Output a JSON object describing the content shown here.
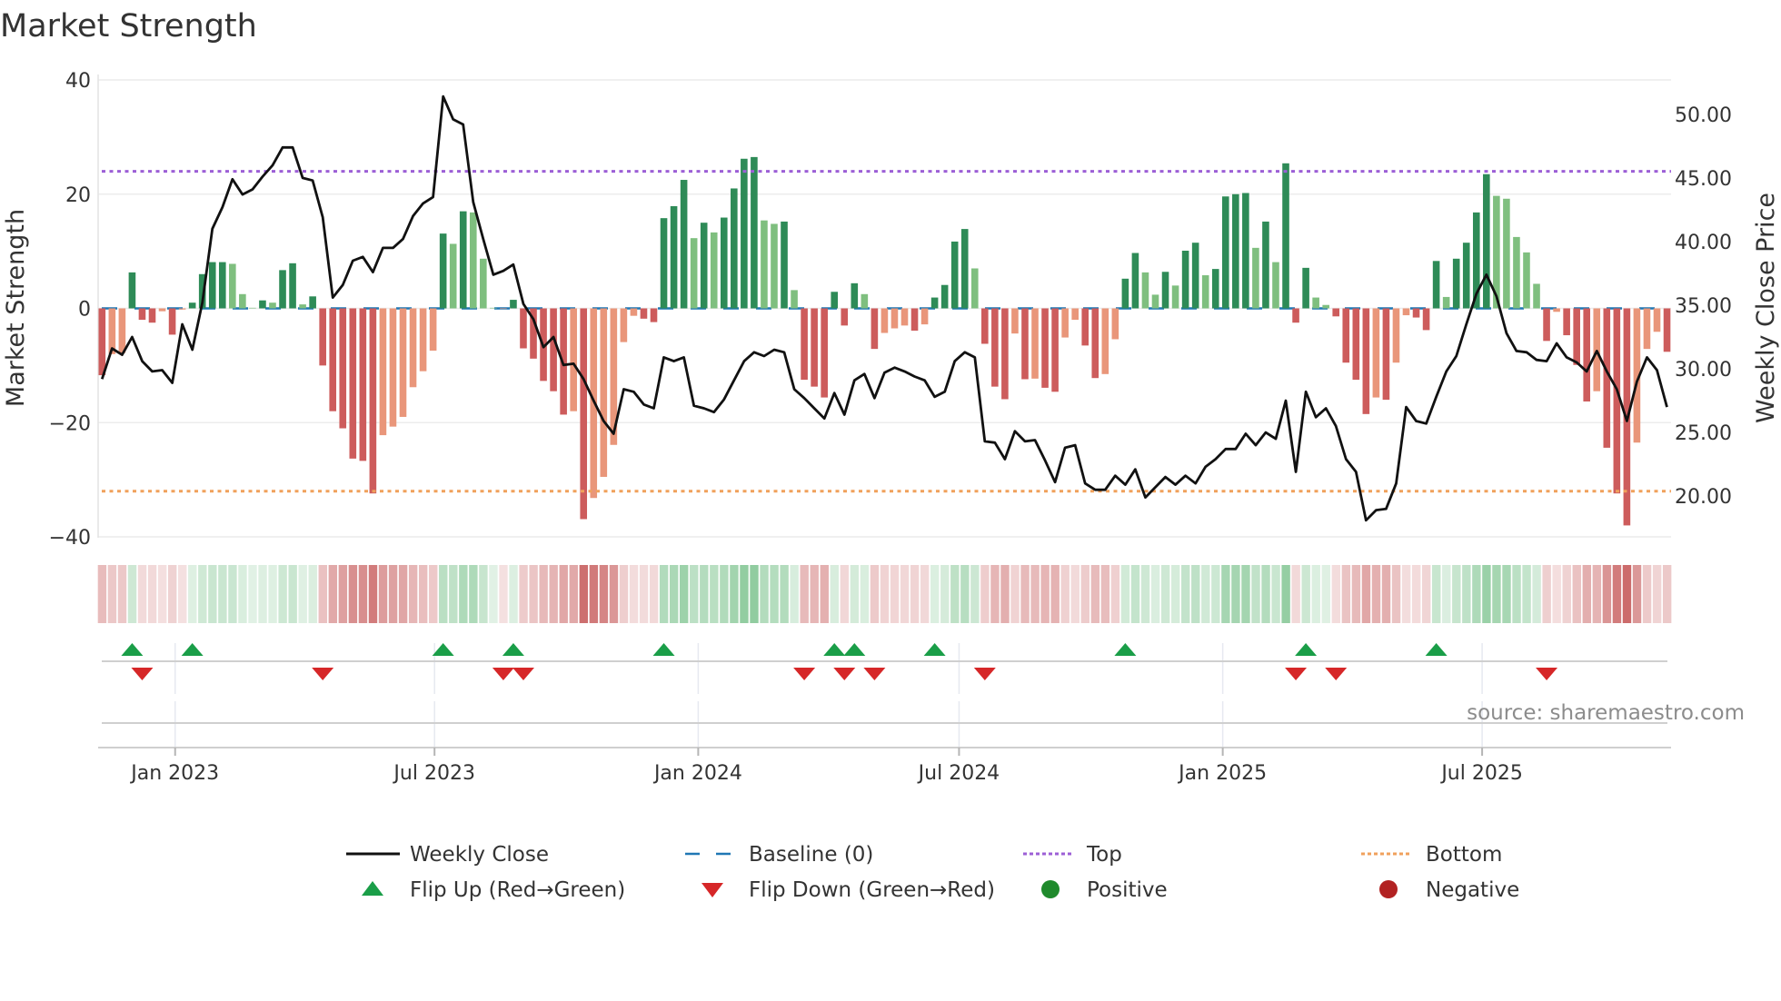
{
  "chart_data": {
    "type": "bar+line",
    "title": "Market Strength",
    "ylabel": "Market Strength",
    "ylabel_right": "Weekly Close Price",
    "ylim": [
      -40,
      40
    ],
    "ylim_right": [
      16.8,
      52.7
    ],
    "y_ticks": [
      {
        "value": 40,
        "label": "40"
      },
      {
        "value": 20,
        "label": "20"
      },
      {
        "value": 0,
        "label": "0"
      },
      {
        "value": -20,
        "label": "−20"
      },
      {
        "value": -40,
        "label": "−40"
      }
    ],
    "y_ticks_right": [
      {
        "value": 50,
        "label": "50.00"
      },
      {
        "value": 45,
        "label": "45.00"
      },
      {
        "value": 40,
        "label": "40.00"
      },
      {
        "value": 35,
        "label": "35.00"
      },
      {
        "value": 30,
        "label": "30.00"
      },
      {
        "value": 25,
        "label": "25.00"
      },
      {
        "value": 20,
        "label": "20.00"
      }
    ],
    "x_start": "2022-11-11",
    "x_step_days": 7,
    "x_ticks": [
      {
        "date": "2023-01-01",
        "label": "Jan 2023"
      },
      {
        "date": "2023-07-01",
        "label": "Jul 2023"
      },
      {
        "date": "2024-01-01",
        "label": "Jan 2024"
      },
      {
        "date": "2024-07-01",
        "label": "Jul 2024"
      },
      {
        "date": "2025-01-01",
        "label": "Jan 2025"
      },
      {
        "date": "2025-07-01",
        "label": "Jul 2025"
      }
    ],
    "top_level": 24,
    "bottom_level": -32,
    "baseline": 0,
    "grid": true,
    "strength": [
      -11.7,
      -8,
      -7.8,
      6.3,
      -2,
      -2.5,
      -0.5,
      -4.6,
      -0.2,
      1,
      6,
      8.1,
      8.1,
      7.8,
      2.5,
      0.1,
      1.4,
      1,
      6.7,
      7.9,
      0.7,
      2.1,
      -10,
      -18,
      -21,
      -26.3,
      -26.7,
      -32.4,
      -22.2,
      -20.7,
      -19,
      -13.8,
      -11,
      -7.4,
      13.1,
      11.3,
      17,
      16.8,
      8.7,
      0.1,
      -0.1,
      1.5,
      -7,
      -8.8,
      -12.7,
      -14.5,
      -18.6,
      -18,
      -36.9,
      -33.2,
      -29.5,
      -23.9,
      -5.9,
      -1.3,
      -1.8,
      -2.4,
      15.8,
      17.9,
      22.5,
      12.3,
      15,
      13.3,
      15.9,
      21,
      26.2,
      26.5,
      15.4,
      14.8,
      15.2,
      3.2,
      -12.5,
      -13.7,
      -15.6,
      2.9,
      -3,
      4.4,
      2.5,
      -7.1,
      -4.3,
      -3.5,
      -3,
      -3.9,
      -2.8,
      1.9,
      4.1,
      11.7,
      13.9,
      7,
      -6.2,
      -13.7,
      -15.9,
      -4.4,
      -12.4,
      -12.3,
      -13.9,
      -14.6,
      -5.1,
      -2,
      -6.5,
      -12.2,
      -11.5,
      -5.4,
      5.2,
      9.7,
      6.3,
      2.4,
      6.4,
      4,
      10.1,
      11.5,
      5.8,
      6.9,
      19.6,
      20,
      20.2,
      10.6,
      15.2,
      8.1,
      25.4,
      -2.5,
      7.1,
      1.9,
      0.6,
      -1.4,
      -9.5,
      -12.5,
      -18.5,
      -15.6,
      -16,
      -9.5,
      -1.2,
      -1.6,
      -3.8,
      8.3,
      2,
      8.7,
      11.5,
      16.8,
      23.5,
      19.7,
      19.2,
      12.5,
      9.8,
      4.3,
      -5.7,
      -0.6,
      -4.7,
      -9.9,
      -16.3,
      -14.5,
      -24.4,
      -32.4,
      -38,
      -23.5,
      -7.1,
      -4.1,
      -7.6
    ],
    "strengthening": [
      1,
      0,
      0,
      1,
      1,
      1,
      0,
      1,
      0,
      1,
      1,
      1,
      1,
      0,
      0,
      0,
      1,
      0,
      1,
      1,
      0,
      1,
      1,
      1,
      1,
      1,
      1,
      1,
      0,
      0,
      0,
      0,
      0,
      0,
      1,
      0,
      1,
      0,
      0,
      0,
      0,
      1,
      1,
      1,
      1,
      1,
      1,
      0,
      1,
      0,
      0,
      0,
      0,
      0,
      1,
      1,
      1,
      1,
      1,
      0,
      1,
      0,
      1,
      1,
      1,
      1,
      0,
      0,
      1,
      0,
      1,
      1,
      1,
      1,
      1,
      1,
      0,
      1,
      0,
      0,
      0,
      1,
      0,
      1,
      1,
      1,
      1,
      0,
      1,
      1,
      1,
      0,
      1,
      0,
      1,
      1,
      0,
      0,
      1,
      1,
      0,
      0,
      1,
      1,
      0,
      0,
      1,
      0,
      1,
      1,
      0,
      1,
      1,
      1,
      1,
      0,
      1,
      0,
      1,
      1,
      1,
      0,
      0,
      1,
      1,
      1,
      1,
      0,
      1,
      0,
      0,
      1,
      1,
      1,
      0,
      1,
      1,
      1,
      1,
      0,
      0,
      0,
      0,
      0,
      1,
      0,
      1,
      1,
      1,
      0,
      1,
      1,
      1,
      0,
      0,
      0,
      1
    ],
    "weekly_close": [
      29.2,
      31.6,
      31.1,
      32.5,
      30.6,
      29.8,
      29.9,
      28.9,
      33.5,
      31.5,
      35.2,
      41.0,
      42.7,
      44.9,
      43.7,
      44.1,
      45.1,
      46.0,
      47.4,
      47.4,
      45.0,
      44.8,
      41.9,
      35.6,
      36.6,
      38.5,
      38.8,
      37.6,
      39.5,
      39.5,
      40.2,
      42.0,
      43.0,
      43.5,
      51.4,
      49.6,
      49.2,
      43.1,
      40.2,
      37.4,
      37.7,
      38.2,
      35.1,
      33.9,
      31.7,
      32.5,
      30.3,
      30.4,
      29.2,
      27.5,
      25.9,
      24.9,
      28.4,
      28.2,
      27.2,
      26.9,
      30.9,
      30.6,
      30.9,
      27.1,
      26.9,
      26.6,
      27.6,
      29.1,
      30.6,
      31.3,
      31.0,
      31.5,
      31.3,
      28.4,
      27.7,
      26.9,
      26.1,
      28.1,
      26.4,
      29.1,
      29.6,
      27.7,
      29.7,
      30.1,
      29.8,
      29.4,
      29.1,
      27.8,
      28.2,
      30.6,
      31.3,
      30.9,
      24.3,
      24.2,
      22.9,
      25.1,
      24.3,
      24.4,
      22.8,
      21.1,
      23.8,
      24.0,
      21.0,
      20.5,
      20.5,
      21.6,
      20.9,
      22.1,
      19.9,
      20.7,
      21.5,
      20.9,
      21.6,
      21.0,
      22.3,
      22.9,
      23.7,
      23.7,
      24.9,
      24.0,
      25.0,
      24.5,
      27.5,
      21.9,
      28.2,
      26.2,
      26.9,
      25.5,
      22.9,
      21.9,
      18.1,
      18.9,
      19.0,
      21.0,
      27.0,
      25.9,
      25.7,
      27.8,
      29.8,
      31.0,
      33.5,
      35.9,
      37.4,
      35.7,
      32.8,
      31.4,
      31.3,
      30.7,
      30.6,
      32.0,
      30.9,
      30.5,
      29.8,
      31.4,
      29.8,
      28.4,
      25.9,
      29.0,
      30.9,
      29.9,
      27.0
    ],
    "flip_up_weeks": [
      4,
      10,
      35,
      42,
      57,
      74,
      76,
      84,
      103,
      121,
      134
    ],
    "flip_down_weeks": [
      5,
      23,
      41,
      43,
      71,
      75,
      78,
      89,
      120,
      124,
      145
    ],
    "legend": {
      "placement": "bottom",
      "items": [
        {
          "key": "close",
          "label": "Weekly Close"
        },
        {
          "key": "baseline",
          "label": "Baseline (0)"
        },
        {
          "key": "top",
          "label": "Top"
        },
        {
          "key": "bottom",
          "label": "Bottom"
        },
        {
          "key": "flip_up",
          "label": "Flip Up (Red→Green)"
        },
        {
          "key": "flip_down",
          "label": "Flip Down (Green→Red)"
        },
        {
          "key": "positive",
          "label": "Positive"
        },
        {
          "key": "negative",
          "label": "Negative"
        }
      ]
    },
    "source": "source: sharemaestro.com"
  },
  "colors": {
    "pos_dark": "#2e8b57",
    "pos_light": "#7fbf7f",
    "neg_dark": "#cd5c5c",
    "neg_light": "#e9967a",
    "baseline": "#1f77b4",
    "top": "#9c5fd6",
    "bottom": "#f0a15c",
    "flip_up": "#1a9e48",
    "flip_down": "#d62728",
    "positive": "#1f8a2c",
    "negative": "#b22222",
    "line": "#111111"
  }
}
